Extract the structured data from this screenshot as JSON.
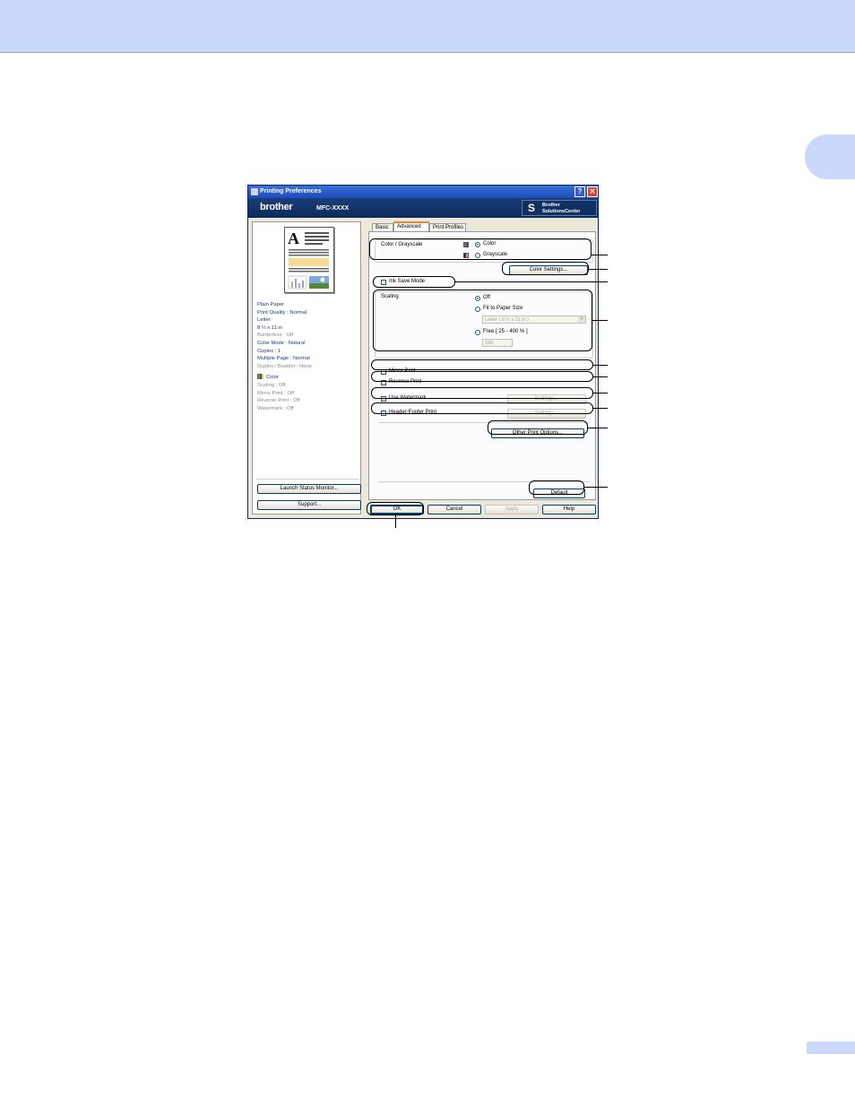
{
  "page": {
    "chapter_tab": "",
    "page_number": ""
  },
  "dialog": {
    "title": "Printing Preferences",
    "help_button": "?",
    "close_button": "✕",
    "brand": "brother",
    "model": "MFC-XXXX",
    "solutions_center": [
      "Brother",
      "SolutionsCenter"
    ],
    "tabs": [
      {
        "label": "Basic",
        "selected": false
      },
      {
        "label": "Advanced",
        "selected": true
      },
      {
        "label": "Print Profiles",
        "selected": false
      }
    ],
    "left_panel": {
      "preview_letter": "A",
      "settings_on": [
        "Plain Paper",
        "Print Quality : Normal",
        "Letter",
        "8 ½ x 11 in"
      ],
      "settings_off_1": [
        "Borderless : Off"
      ],
      "settings_on_2": [
        "Color Mode : Natural",
        "Copies : 1",
        "Multiple Page : Normal"
      ],
      "settings_off_2": [
        "Duplex / Booklet : None"
      ],
      "color_label": "Color",
      "settings_off_3": [
        "Scaling : Off",
        "Mirror Print : Off",
        "Reverse Print : Off",
        "Watermark : Off"
      ],
      "launch_status_monitor": "Launch Status Monitor...",
      "support": "Support..."
    },
    "advanced": {
      "color_grayscale_label": "Color / Grayscale",
      "color_option": "Color",
      "grayscale_option": "Grayscale",
      "color_settings_button": "Color Settings...",
      "ink_save_mode": "Ink Save Mode",
      "scaling_label": "Scaling",
      "scaling_off": "Off",
      "fit_to_paper": "Fit to Paper Size",
      "paper_size_value": "Letter ( 8 ½ x 11 in )",
      "free_option": "Free [ 25 - 400 % ]",
      "free_value": "100",
      "mirror_print": "Mirror Print",
      "reverse_print": "Reverse Print",
      "use_watermark": "Use Watermark",
      "watermark_settings": "Settings...",
      "header_footer_print": "Header-Footer Print",
      "header_footer_settings": "Settings...",
      "other_print_options": "Other Print Options...",
      "default_button": "Default"
    },
    "footer": {
      "ok": "OK",
      "cancel": "Cancel",
      "apply": "Apply",
      "help": "Help"
    }
  }
}
